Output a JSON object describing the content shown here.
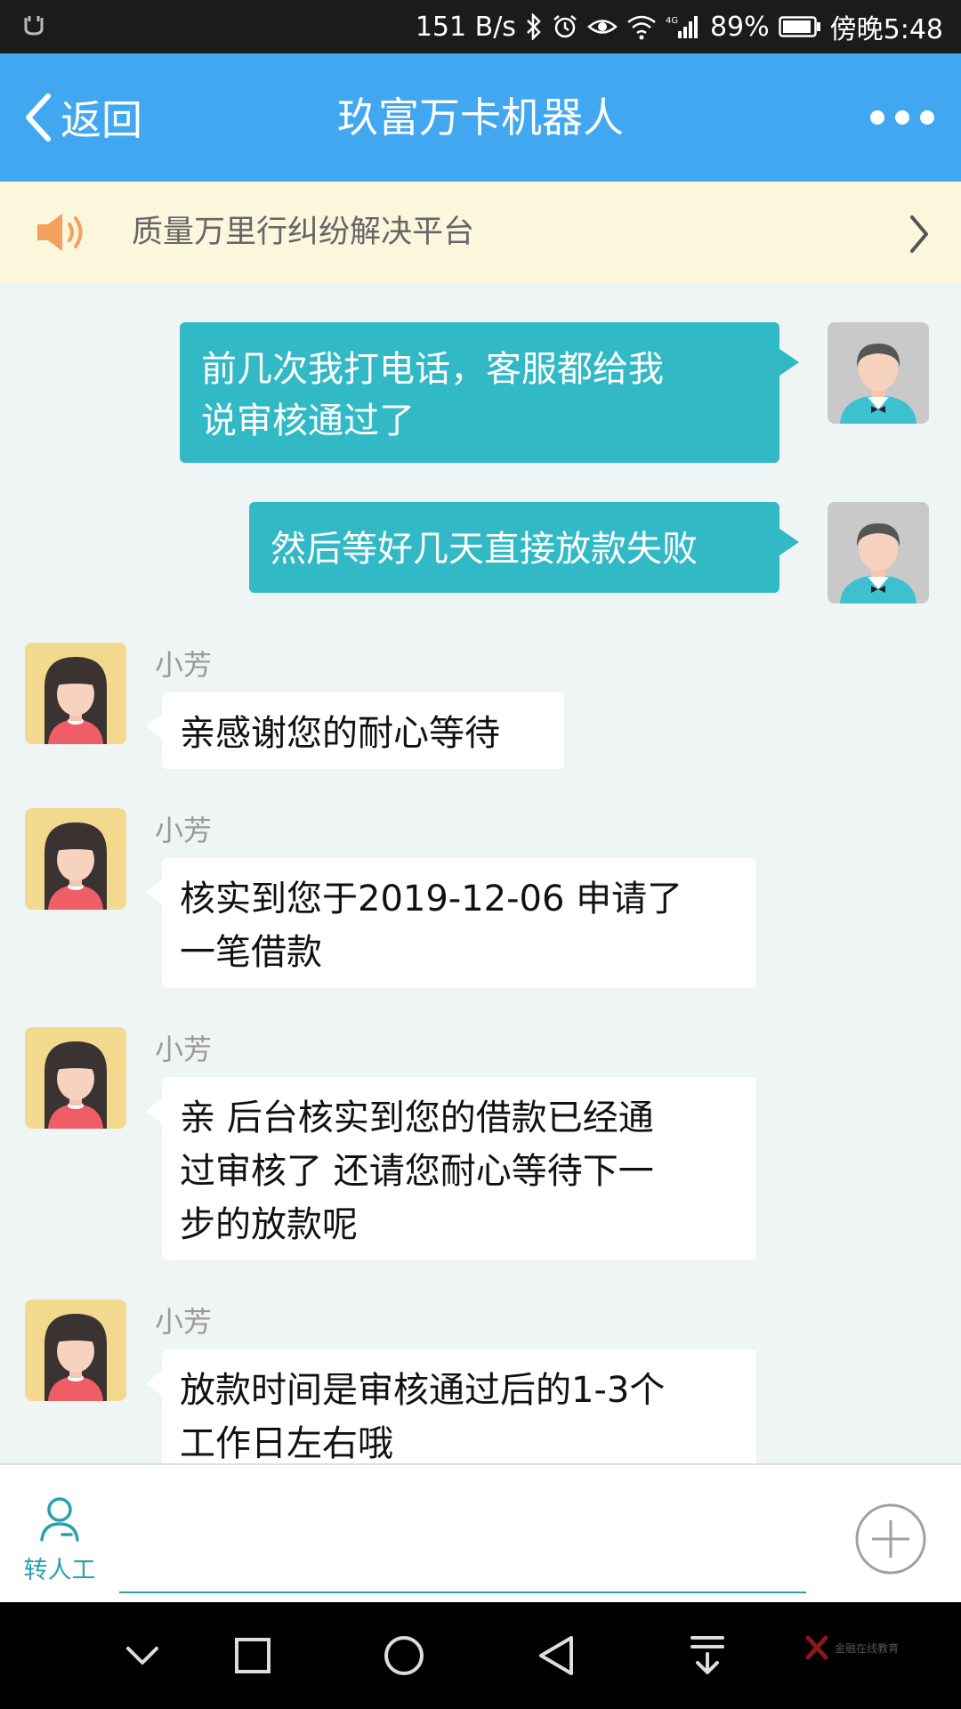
{
  "status_bar": {
    "network_speed": "151 B/s",
    "battery": "89%",
    "time": "傍晚5:48"
  },
  "header": {
    "back_label": "返回",
    "title": "玖富万卡机器人"
  },
  "notice": {
    "text": "质量万里行纠纷解决平台"
  },
  "messages": {
    "m1": {
      "lines": [
        "前几次我打电话，客服都给我",
        "说审核通过了"
      ]
    },
    "m2": {
      "lines": [
        "然后等好几天直接放款失败"
      ]
    },
    "m3": {
      "sender": "小芳",
      "lines": [
        "亲感谢您的耐心等待"
      ]
    },
    "m4": {
      "sender": "小芳",
      "lines": [
        "核实到您于2019-12-06 申请了",
        "一笔借款"
      ]
    },
    "m5": {
      "sender": "小芳",
      "lines": [
        "亲 后台核实到您的借款已经通",
        "过审核了 还请您耐心等待下一",
        "步的放款呢"
      ]
    },
    "m6": {
      "sender": "小芳",
      "lines": [
        "放款时间是审核通过后的1-3个",
        "工作日左右哦"
      ]
    }
  },
  "input_bar": {
    "agent_label": "转人工"
  },
  "watermark": "金融在线教育",
  "colors": {
    "header": "#41a7f0",
    "outgoing_bubble": "#31b9c6",
    "notice_bg": "#fcf6dd",
    "chat_bg": "#eff4f5",
    "accent": "#29a1ad"
  }
}
